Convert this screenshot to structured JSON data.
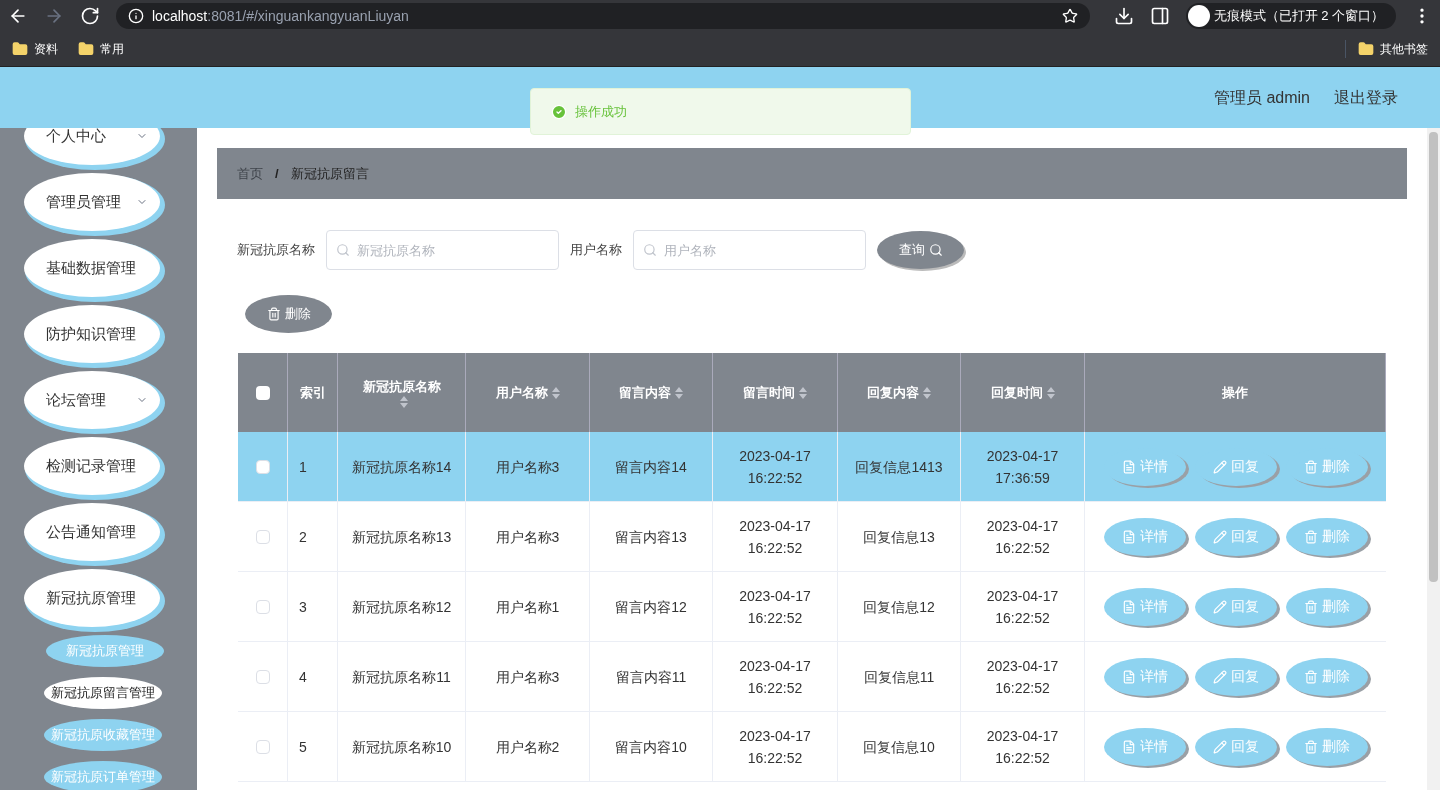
{
  "browser": {
    "url_host": "localhost",
    "url_rest": ":8081/#/xinguankangyuanLiuyan",
    "incognito": "无痕模式（已打开 2 个窗口）",
    "bookmarks": [
      "资料",
      "常用"
    ],
    "other_bookmarks": "其他书签"
  },
  "header": {
    "user": "管理员 admin",
    "logout": "退出登录"
  },
  "toast": {
    "message": "操作成功"
  },
  "sidebar": {
    "items": [
      {
        "label": "个人中心",
        "has_caret": true
      },
      {
        "label": "管理员管理",
        "has_caret": true
      },
      {
        "label": "基础数据管理",
        "has_caret": false
      },
      {
        "label": "防护知识管理",
        "has_caret": false
      },
      {
        "label": "论坛管理",
        "has_caret": true
      },
      {
        "label": "检测记录管理",
        "has_caret": false
      },
      {
        "label": "公告通知管理",
        "has_caret": false
      },
      {
        "label": "新冠抗原管理",
        "has_caret": false,
        "children": [
          {
            "label": "新冠抗原管理",
            "selected": false
          },
          {
            "label": "新冠抗原留言管理",
            "selected": true
          },
          {
            "label": "新冠抗原收藏管理",
            "selected": false
          },
          {
            "label": "新冠抗原订单管理",
            "selected": false
          }
        ]
      }
    ]
  },
  "breadcrumb": {
    "home": "首页",
    "separator": "/",
    "current": "新冠抗原留言"
  },
  "search": {
    "fields": [
      {
        "label": "新冠抗原名称",
        "placeholder": "新冠抗原名称"
      },
      {
        "label": "用户名称",
        "placeholder": "用户名称"
      }
    ],
    "button": "查询"
  },
  "bulk_delete": "删除",
  "table": {
    "select_all_checked": false,
    "columns": [
      {
        "label": "索引",
        "sortable": false
      },
      {
        "label": "新冠抗原名称",
        "sortable": true
      },
      {
        "label": "用户名称",
        "sortable": true
      },
      {
        "label": "留言内容",
        "sortable": true
      },
      {
        "label": "留言时间",
        "sortable": true
      },
      {
        "label": "回复内容",
        "sortable": true
      },
      {
        "label": "回复时间",
        "sortable": true
      },
      {
        "label": "操作",
        "sortable": false
      }
    ],
    "rows": [
      {
        "checked": false,
        "highlighted": true,
        "cells": [
          "1",
          "新冠抗原名称14",
          "用户名称3",
          "留言内容14",
          "2023-04-17 16:22:52",
          "回复信息1413",
          "2023-04-17 17:36:59"
        ],
        "actions": [
          "详情",
          "回复",
          "删除"
        ]
      },
      {
        "checked": false,
        "highlighted": false,
        "cells": [
          "2",
          "新冠抗原名称13",
          "用户名称3",
          "留言内容13",
          "2023-04-17 16:22:52",
          "回复信息13",
          "2023-04-17 16:22:52"
        ],
        "actions": [
          "详情",
          "回复",
          "删除"
        ]
      },
      {
        "checked": false,
        "highlighted": false,
        "cells": [
          "3",
          "新冠抗原名称12",
          "用户名称1",
          "留言内容12",
          "2023-04-17 16:22:52",
          "回复信息12",
          "2023-04-17 16:22:52"
        ],
        "actions": [
          "详情",
          "回复",
          "删除"
        ]
      },
      {
        "checked": false,
        "highlighted": false,
        "cells": [
          "4",
          "新冠抗原名称11",
          "用户名称3",
          "留言内容11",
          "2023-04-17 16:22:52",
          "回复信息11",
          "2023-04-17 16:22:52"
        ],
        "actions": [
          "详情",
          "回复",
          "删除"
        ]
      },
      {
        "checked": false,
        "highlighted": false,
        "cells": [
          "5",
          "新冠抗原名称10",
          "用户名称2",
          "留言内容10",
          "2023-04-17 16:22:52",
          "回复信息10",
          "2023-04-17 16:22:52"
        ],
        "actions": [
          "详情",
          "回复",
          "删除"
        ]
      }
    ]
  }
}
